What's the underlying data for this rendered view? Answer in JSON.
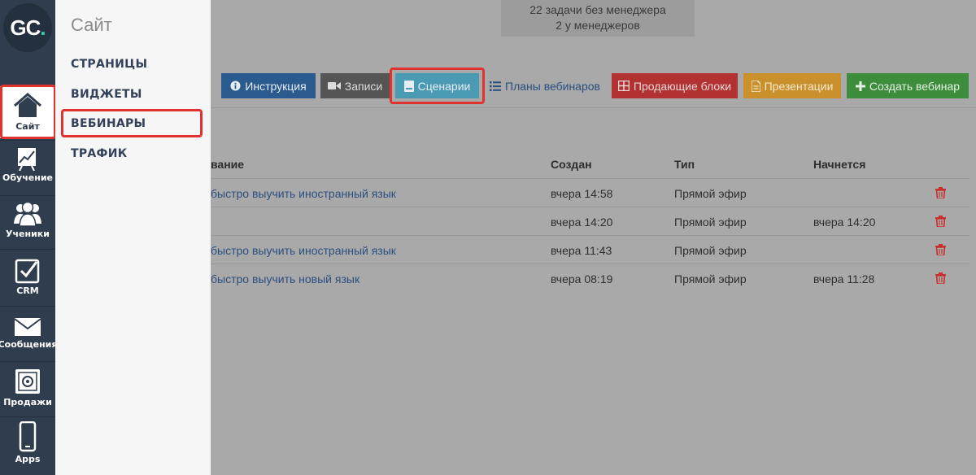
{
  "logo": {
    "text_main": "GC",
    "text_dot": "."
  },
  "sidebar": {
    "items": [
      {
        "label": "Сайт",
        "icon": "home-icon",
        "active": true
      },
      {
        "label": "Обучение",
        "icon": "chart-board-icon"
      },
      {
        "label": "Ученики",
        "icon": "users-icon"
      },
      {
        "label": "CRM",
        "icon": "checkbox-icon"
      },
      {
        "label": "Сообщения",
        "icon": "envelope-icon"
      },
      {
        "label": "Продажи",
        "icon": "safe-icon"
      },
      {
        "label": "Apps",
        "icon": "phone-icon"
      }
    ]
  },
  "submenu": {
    "title": "Сайт",
    "items": [
      "СТРАНИЦЫ",
      "ВИДЖЕТЫ",
      "ВЕБИНАРЫ",
      "ТРАФИК"
    ]
  },
  "info": {
    "line1": "22 задачи без менеджера",
    "line2": "2 у менеджеров"
  },
  "toolbar": {
    "instruction": "Инструкция",
    "records": "Записи",
    "scenarios": "Сценарии",
    "plans": "Планы вебинаров",
    "selling_blocks": "Продающие блоки",
    "presentations": "Презентации",
    "create": "Создать вебинар"
  },
  "colors": {
    "instruction": "#2a5a8e",
    "records": "#555555",
    "scenarios": "#4a9ab4",
    "selling_blocks": "#b23232",
    "presentations": "#c9902c",
    "create": "#3d8d3d",
    "highlight": "#e0322f"
  },
  "table": {
    "headers": {
      "name": "вание",
      "created": "Создан",
      "type": "Тип",
      "starts": "Начнется"
    },
    "rows": [
      {
        "name": "быстро выучить иностранный язык",
        "created": "вчера 14:58",
        "type": "Прямой эфир",
        "starts": ""
      },
      {
        "name": "",
        "created": "вчера 14:20",
        "type": "Прямой эфир",
        "starts": "вчера 14:20"
      },
      {
        "name": "быстро выучить иностранный язык",
        "created": "вчера 11:43",
        "type": "Прямой эфир",
        "starts": ""
      },
      {
        "name": "быстро выучить новый язык",
        "created": "вчера 08:19",
        "type": "Прямой эфир",
        "starts": "вчера 11:28"
      }
    ]
  }
}
